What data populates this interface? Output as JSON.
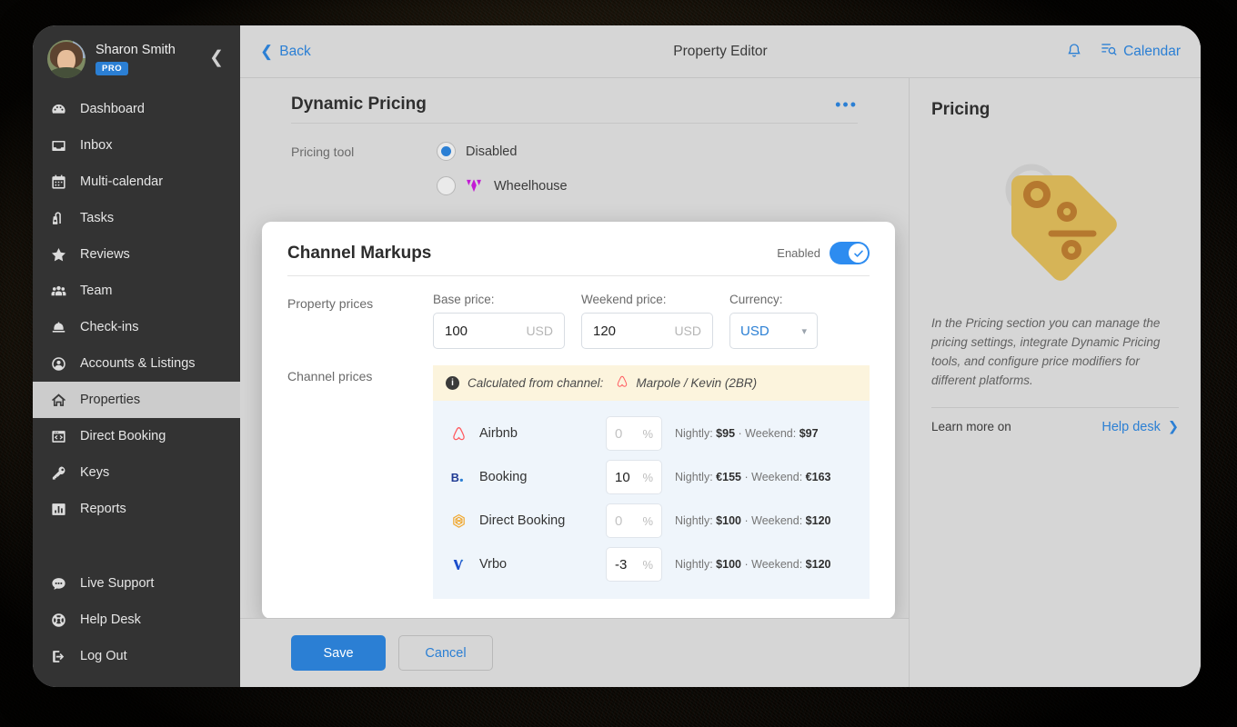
{
  "sidebar": {
    "profile": {
      "name": "Sharon Smith",
      "badge": "PRO",
      "collapse_icon": "chevron-left-icon"
    },
    "items": [
      {
        "label": "Dashboard",
        "icon": "dashboard-icon",
        "active": false
      },
      {
        "label": "Inbox",
        "icon": "inbox-icon",
        "active": false
      },
      {
        "label": "Multi-calendar",
        "icon": "calendar-icon",
        "active": false
      },
      {
        "label": "Tasks",
        "icon": "tasks-icon",
        "active": false
      },
      {
        "label": "Reviews",
        "icon": "star-icon",
        "active": false
      },
      {
        "label": "Team",
        "icon": "team-icon",
        "active": false
      },
      {
        "label": "Check-ins",
        "icon": "bell-desk-icon",
        "active": false
      },
      {
        "label": "Accounts & Listings",
        "icon": "account-circle-icon",
        "active": false
      },
      {
        "label": "Properties",
        "icon": "home-icon",
        "active": true
      },
      {
        "label": "Direct Booking",
        "icon": "code-window-icon",
        "active": false
      },
      {
        "label": "Keys",
        "icon": "key-icon",
        "active": false
      },
      {
        "label": "Reports",
        "icon": "bar-chart-icon",
        "active": false
      }
    ],
    "bottom_items": [
      {
        "label": "Live Support",
        "icon": "chat-bubble-icon"
      },
      {
        "label": "Help Desk",
        "icon": "lifebuoy-icon"
      },
      {
        "label": "Log Out",
        "icon": "logout-icon"
      }
    ]
  },
  "topbar": {
    "back_label": "Back",
    "title": "Property Editor",
    "notifications_icon": "bell-icon",
    "calendar_label": "Calendar",
    "calendar_icon": "calendar-search-icon"
  },
  "dynamic_pricing": {
    "title": "Dynamic Pricing",
    "more_icon": "ellipsis-icon",
    "field_label": "Pricing tool",
    "options": [
      {
        "label": "Disabled",
        "selected": true
      },
      {
        "label": "Wheelhouse",
        "selected": false,
        "icon": "wheelhouse-logo-icon"
      }
    ]
  },
  "channel_markups": {
    "title": "Channel Markups",
    "toggle_label": "Enabled",
    "toggle_on": true,
    "property_prices_label": "Property prices",
    "base_price": {
      "label": "Base price:",
      "value": "100",
      "suffix": "USD"
    },
    "weekend_price": {
      "label": "Weekend price:",
      "value": "120",
      "suffix": "USD"
    },
    "currency": {
      "label": "Currency:",
      "value": "USD"
    },
    "channel_prices_label": "Channel prices",
    "info_banner": {
      "text": "Calculated from channel:",
      "channel": "Marpole / Kevin (2BR)",
      "channel_icon": "airbnb-icon",
      "info_icon": "info-icon"
    },
    "channels": [
      {
        "name": "Airbnb",
        "icon": "airbnb-icon",
        "markup": "0",
        "markup_empty": true,
        "percent": "%",
        "nightly_label": "Nightly:",
        "nightly": "$95",
        "sep": "·",
        "weekend_label": "Weekend:",
        "weekend": "$97"
      },
      {
        "name": "Booking",
        "icon": "booking-icon",
        "markup": "10",
        "markup_empty": false,
        "percent": "%",
        "nightly_label": "Nightly:",
        "nightly": "€155",
        "sep": "·",
        "weekend_label": "Weekend:",
        "weekend": "€163"
      },
      {
        "name": "Direct Booking",
        "icon": "direct-booking-icon",
        "markup": "0",
        "markup_empty": true,
        "percent": "%",
        "nightly_label": "Nightly:",
        "nightly": "$100",
        "sep": "·",
        "weekend_label": "Weekend:",
        "weekend": "$120"
      },
      {
        "name": "Vrbo",
        "icon": "vrbo-icon",
        "markup": "-3",
        "markup_empty": false,
        "percent": "%",
        "nightly_label": "Nightly:",
        "nightly": "$100",
        "sep": "·",
        "weekend_label": "Weekend:",
        "weekend": "$120"
      }
    ]
  },
  "footer": {
    "save_label": "Save",
    "cancel_label": "Cancel"
  },
  "right_panel": {
    "title": "Pricing",
    "art_icon": "price-tag-icon",
    "description": "In the Pricing section you can manage the pricing settings, integrate Dynamic Pricing tools, and configure price modifiers for different platforms.",
    "learn_more_label": "Learn more on",
    "help_desk_label": "Help desk",
    "help_desk_arrow": "chevron-right-icon"
  },
  "colors": {
    "accent": "#2b7fd4",
    "sidebar_bg": "#333333",
    "app_bg": "#d6d6d6",
    "toggle_on": "#2d8cf0",
    "info_banner_bg": "#fcf4dd",
    "channel_list_bg": "#eff5fb",
    "airbnb": "#ff5a5f",
    "booking": "#1f3a93",
    "direct_booking": "#f0a830",
    "vrbo": "#1c4ecb",
    "wheelhouse": "#c21bd4",
    "price_tag": "#d6b457"
  }
}
